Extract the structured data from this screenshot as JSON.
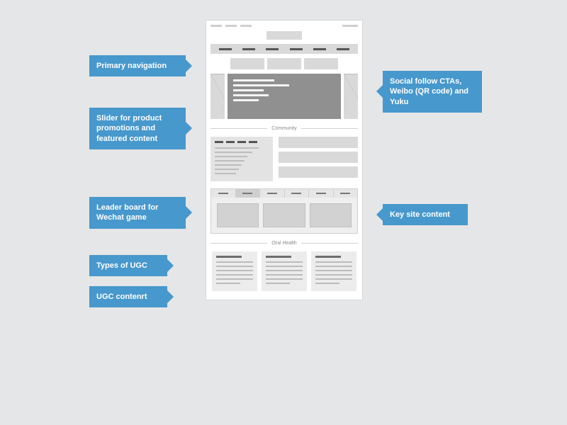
{
  "callouts": {
    "primary_nav": "Primary navigation",
    "slider": "Slider for product promotions and featured content",
    "leaderboard": "Leader board for Wechat game",
    "ugc_types": "Types of UGC",
    "ugc_content": "UGC contenrt",
    "social": "Social follow CTAs, Weibo (QR code) and Yuku",
    "key_content": "Key site content"
  },
  "sections": {
    "community": "Community",
    "oral_health": "Oral Health"
  }
}
